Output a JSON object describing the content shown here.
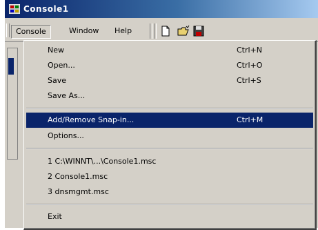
{
  "window": {
    "title": "Console1"
  },
  "menubar": {
    "items": [
      {
        "label": "Console"
      },
      {
        "label": "Window"
      },
      {
        "label": "Help"
      }
    ]
  },
  "console_menu": {
    "items": [
      {
        "label": "New",
        "shortcut": "Ctrl+N"
      },
      {
        "label": "Open...",
        "shortcut": "Ctrl+O"
      },
      {
        "label": "Save",
        "shortcut": "Ctrl+S"
      },
      {
        "label": "Save As..."
      },
      {
        "label": "Add/Remove Snap-in...",
        "shortcut": "Ctrl+M",
        "highlighted": true
      },
      {
        "label": "Options..."
      },
      {
        "label": "1 C:\\WINNT\\...\\Console1.msc"
      },
      {
        "label": "2 Console1.msc"
      },
      {
        "label": "3 dnsmgmt.msc"
      },
      {
        "label": "Exit"
      }
    ]
  },
  "colors": {
    "highlight": "#0a246a",
    "face": "#d4d0c8",
    "title_gradient_end": "#a6caf0"
  },
  "icons": [
    "mmc-app-icon",
    "new-document-icon",
    "open-folder-icon",
    "save-disk-icon"
  ]
}
